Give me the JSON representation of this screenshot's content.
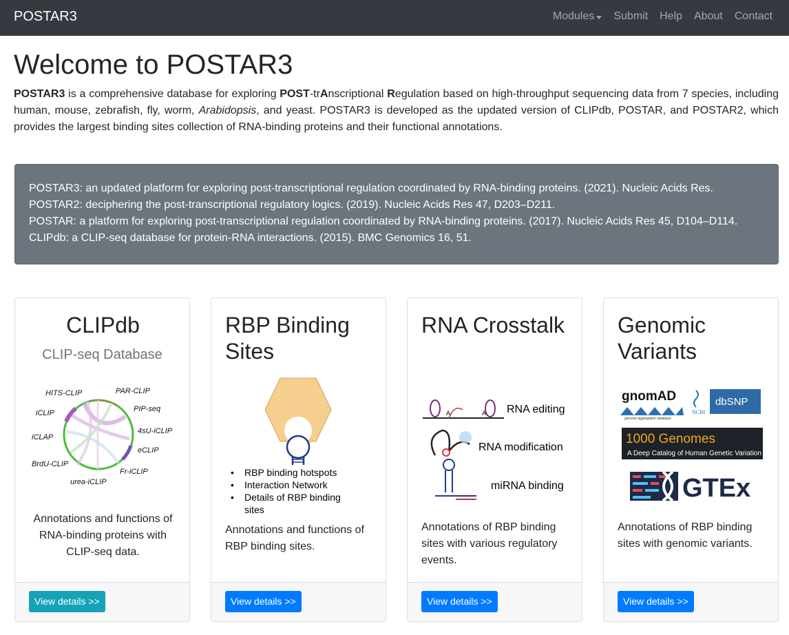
{
  "navbar": {
    "brand": "POSTAR3",
    "items": [
      "Modules",
      "Submit",
      "Help",
      "About",
      "Contact"
    ]
  },
  "page": {
    "title": "Welcome to POSTAR3",
    "intro": {
      "name": "POSTAR3",
      "text1": " is a comprehensive database for exploring ",
      "post": "POST",
      "tr": "-tr",
      "a": "A",
      "nscriptional": "nscriptional ",
      "r": "R",
      "text2": "egulation based on high-throughput sequencing data from 7 species, including human, mouse, zebrafish, fly, worm, ",
      "arabidopsis": "Arabidopsis",
      "text3": ", and yeast. POSTAR3 is developed as the updated version of CLIPdb, POSTAR, and POSTAR2, which provides the largest binding sites collection of RNA-binding proteins and their functional annotations."
    }
  },
  "publications": [
    "POSTAR3: an updated platform for exploring post-transcriptional regulation coordinated by RNA-binding proteins. (2021). Nucleic Acids Res.",
    "POSTAR2: deciphering the post-transcriptional regulatory logics. (2019). Nucleic Acids Res 47, D203–D211.",
    "POSTAR: a platform for exploring post-transcriptional regulation coordinated by RNA-binding proteins. (2017). Nucleic Acids Res 45, D104–D114.",
    "CLIPdb: a CLIP-seq database for protein-RNA interactions. (2015). BMC Genomics 16, 51."
  ],
  "cards": [
    {
      "title": "CLIPdb",
      "subtitle": "CLIP-seq Database",
      "figure_labels": [
        "HITS-CLIP",
        "PAR-CLIP",
        "iCLIP",
        "PIP-seq",
        "iCLAP",
        "4sU-iCLIP",
        "eCLIP",
        "BrdU-CLIP",
        "Fr-iCLIP",
        "urea-iCLIP"
      ],
      "description": "Annotations and functions of RNA-binding proteins with CLIP-seq data.",
      "button": "View details >>"
    },
    {
      "title": "RBP Binding Sites",
      "figure_bullets": [
        "RBP binding hotspots",
        "Interaction Network",
        "Details of RBP binding sites"
      ],
      "description": "Annotations and functions of RBP binding sites.",
      "button": "View details >>"
    },
    {
      "title": "RNA Crosstalk",
      "figure_labels": [
        "RNA editing",
        "RNA modification",
        "miRNA binding"
      ],
      "description": "Annotations of RBP binding sites with various regulatory events.",
      "button": "View details >>"
    },
    {
      "title": "Genomic Variants",
      "logos": {
        "gnomad": "gnomAD",
        "gnomad_sub": "genome aggregation database",
        "ncbi": "NCBI",
        "dbsnp": "dbSNP",
        "kg_title": "1000 Genomes",
        "kg_sub": "A Deep Catalog of Human Genetic Variation",
        "gtex": "GTEx"
      },
      "description": "Annotations of RBP binding sites with genomic variants.",
      "button": "View details >>"
    }
  ],
  "colors": {
    "navbar": "#343a40",
    "pubs_bg": "#6c757d",
    "btn_teal": "#17a2b8",
    "btn_blue": "#007bff"
  }
}
